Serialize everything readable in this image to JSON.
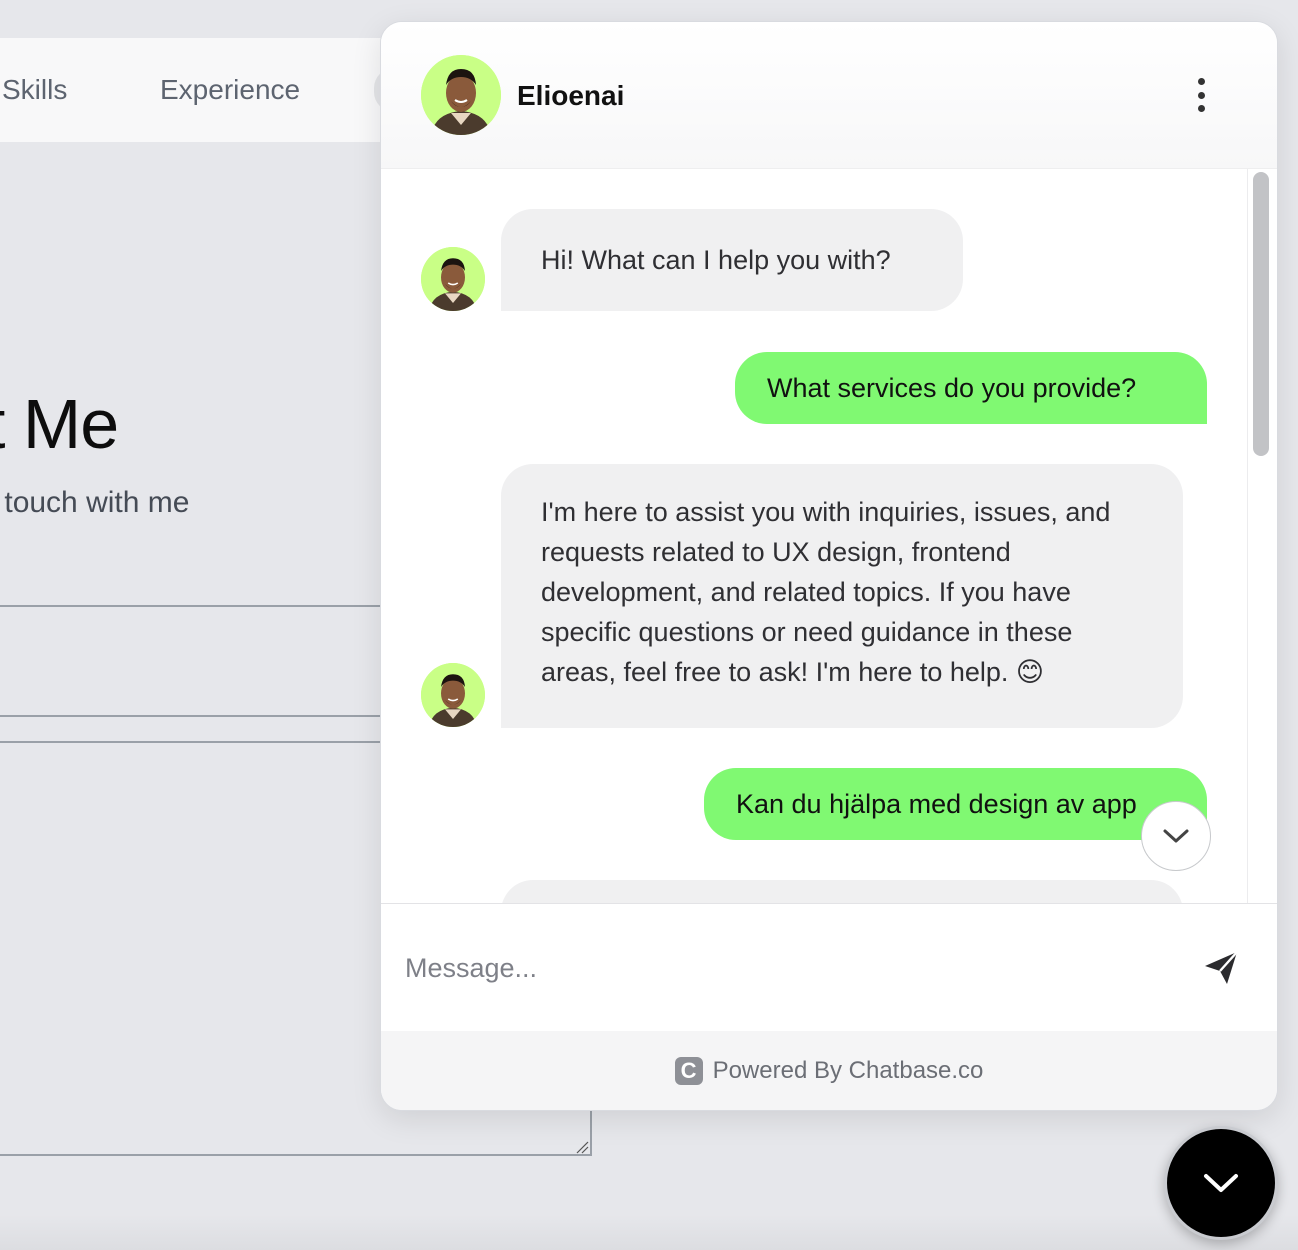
{
  "background": {
    "nav_items": [
      "Skills",
      "Experience"
    ],
    "heading": "ct Me",
    "subheading": "t in touch with me"
  },
  "chat": {
    "name": "Elioenai",
    "messages": [
      {
        "role": "bot",
        "text": "Hi! What can I help you with?"
      },
      {
        "role": "user",
        "text": "What services do you provide?"
      },
      {
        "role": "bot",
        "text": "I'm here to assist you with inquiries, issues, and requests related to UX design, frontend development, and related topics. If you have specific questions or need guidance in these areas, feel free to ask! I'm here to help. 😊"
      },
      {
        "role": "user",
        "text": "Kan du hjälpa med design av app"
      }
    ],
    "input_placeholder": "Message...",
    "footer_logo": "C",
    "footer_text": "Powered By Chatbase.co"
  },
  "colors": {
    "user_bubble": "#80f972",
    "bot_bubble": "#f0f0f1",
    "avatar_bg": "#c9ff86"
  },
  "icons": [
    "kebab-menu-icon",
    "chevron-down-icon",
    "send-icon",
    "chatbase-logo-icon"
  ]
}
